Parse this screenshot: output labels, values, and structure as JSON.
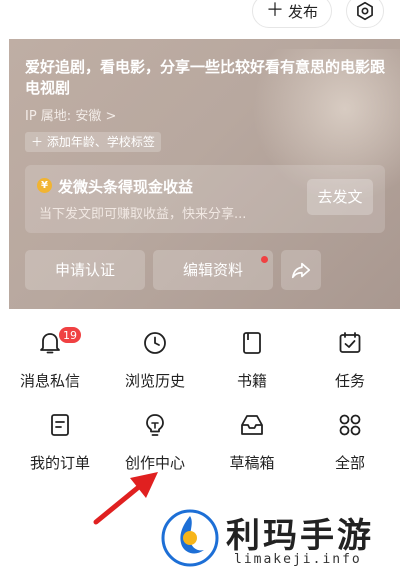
{
  "header": {
    "publish_label": "发布",
    "publish_icon": "plus-icon",
    "settings_icon": "settings-hex-icon"
  },
  "profile": {
    "bio": "爱好追剧，看电影，分享一些比较好看有意思的电影跟电视剧",
    "ip_location": "IP 属地: 安徽 >",
    "add_tag": "＋ 添加年龄、学校标签",
    "earn": {
      "title": "发微头条得现金收益",
      "subtitle": "当下发文即可赚取收益，快来分享...",
      "button": "去发文",
      "coin_glyph": "¥"
    },
    "actions": {
      "apply_verify": "申请认证",
      "edit_profile": "编辑资料",
      "share_icon": "share-arrow-icon",
      "edit_has_dot": true
    }
  },
  "grid": [
    {
      "label": "消息私信",
      "icon": "bell-icon",
      "badge": "19"
    },
    {
      "label": "浏览历史",
      "icon": "clock-icon"
    },
    {
      "label": "书籍",
      "icon": "book-icon"
    },
    {
      "label": "任务",
      "icon": "calendar-check-icon"
    },
    {
      "label": "我的订单",
      "icon": "order-list-icon"
    },
    {
      "label": "创作中心",
      "icon": "lightbulb-icon"
    },
    {
      "label": "草稿箱",
      "icon": "draft-box-icon"
    },
    {
      "label": "全部",
      "icon": "grid-four-icon"
    }
  ],
  "watermark": {
    "title": "利玛手游",
    "url": "limakeji.info"
  },
  "colors": {
    "accent_red": "#f04142",
    "card_bg": "#b8a89f",
    "coin": "#f1b432"
  }
}
